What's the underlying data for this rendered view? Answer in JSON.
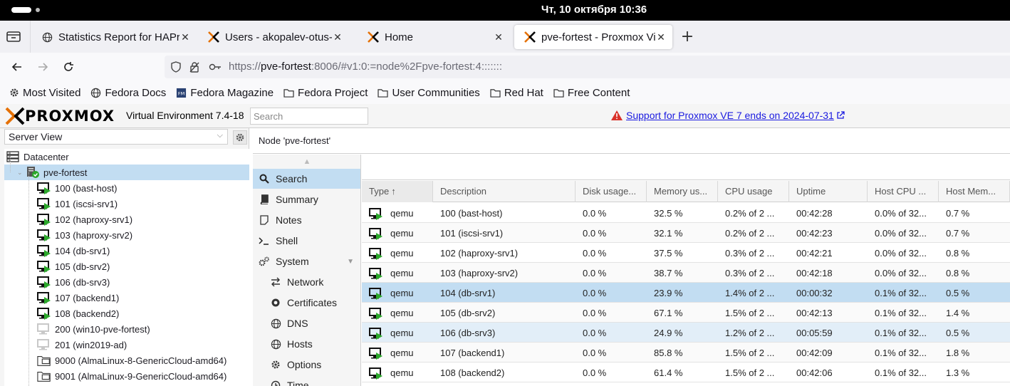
{
  "os": {
    "clock": "Чт, 10 октября  10:36"
  },
  "browser": {
    "tabs": [
      {
        "label": "Statistics Report for HAProxy",
        "icon": "globe-icon",
        "active": false
      },
      {
        "label": "Users - akopalev-otus-hl.ru",
        "icon": "proxmox-x-icon",
        "active": false
      },
      {
        "label": "Home",
        "icon": "proxmox-x-icon",
        "active": false
      },
      {
        "label": "pve-fortest - Proxmox Virtual Environment",
        "icon": "proxmox-x-icon",
        "active": true
      }
    ],
    "url_prefix": "https://",
    "url_host": "pve-fortest",
    "url_rest": ":8006/#v1:0:=node%2Fpve-fortest:4:::::::",
    "bookmarks": [
      {
        "label": "Most Visited",
        "icon": "gear-icon"
      },
      {
        "label": "Fedora Docs",
        "icon": "globe-icon"
      },
      {
        "label": "Fedora Magazine",
        "icon": "fedora-magazine-icon"
      },
      {
        "label": "Fedora Project",
        "icon": "folder-icon"
      },
      {
        "label": "User Communities",
        "icon": "folder-icon"
      },
      {
        "label": "Red Hat",
        "icon": "folder-icon"
      },
      {
        "label": "Free Content",
        "icon": "folder-icon"
      }
    ]
  },
  "pve": {
    "brand": "PROXMOX",
    "version": "Virtual Environment 7.4-18",
    "search_placeholder": "Search",
    "warning": "Support for Proxmox VE 7 ends on 2024-07-31",
    "view": "Server View",
    "tree": [
      {
        "label": "Datacenter",
        "kind": "datacenter"
      },
      {
        "label": "pve-fortest",
        "kind": "node",
        "selected": true
      },
      {
        "label": "100 (bast-host)",
        "kind": "vm-running"
      },
      {
        "label": "101 (iscsi-srv1)",
        "kind": "vm-running"
      },
      {
        "label": "102 (haproxy-srv1)",
        "kind": "vm-running"
      },
      {
        "label": "103 (haproxy-srv2)",
        "kind": "vm-running"
      },
      {
        "label": "104 (db-srv1)",
        "kind": "vm-running"
      },
      {
        "label": "105 (db-srv2)",
        "kind": "vm-running"
      },
      {
        "label": "106 (db-srv3)",
        "kind": "vm-running"
      },
      {
        "label": "107 (backend1)",
        "kind": "vm-running"
      },
      {
        "label": "108 (backend2)",
        "kind": "vm-running"
      },
      {
        "label": "200 (win10-pve-fortest)",
        "kind": "vm-stopped"
      },
      {
        "label": "201 (win2019-ad)",
        "kind": "vm-stopped"
      },
      {
        "label": "9000 (AlmaLinux-8-GenericCloud-amd64)",
        "kind": "template"
      },
      {
        "label": "9001 (AlmaLinux-9-GenericCloud-amd64)",
        "kind": "template"
      }
    ],
    "node_title": "Node 'pve-fortest'",
    "menu": [
      {
        "label": "Search",
        "icon": "search-icon",
        "selected": true
      },
      {
        "label": "Summary",
        "icon": "book-icon"
      },
      {
        "label": "Notes",
        "icon": "note-icon"
      },
      {
        "label": "Shell",
        "icon": "terminal-icon"
      },
      {
        "label": "System",
        "icon": "cogs-icon",
        "expandable": true
      },
      {
        "label": "Network",
        "icon": "network-icon",
        "sub": true
      },
      {
        "label": "Certificates",
        "icon": "certificate-icon",
        "sub": true
      },
      {
        "label": "DNS",
        "icon": "globe-icon",
        "sub": true
      },
      {
        "label": "Hosts",
        "icon": "globe-icon",
        "sub": true
      },
      {
        "label": "Options",
        "icon": "gear-icon",
        "sub": true
      },
      {
        "label": "Time",
        "icon": "clock-icon",
        "sub": true
      }
    ],
    "grid": {
      "columns": [
        "Type",
        "Description",
        "Disk usage...",
        "Memory us...",
        "CPU usage",
        "Uptime",
        "Host CPU ...",
        "Host Mem..."
      ],
      "sort_indicator": "↑",
      "rows": [
        [
          "qemu",
          "100 (bast-host)",
          "0.0 %",
          "32.5 %",
          "0.2% of 2 ...",
          "00:42:28",
          "0.0% of 32...",
          "0.7 %"
        ],
        [
          "qemu",
          "101 (iscsi-srv1)",
          "0.0 %",
          "32.1 %",
          "0.2% of 2 ...",
          "00:42:23",
          "0.0% of 32...",
          "0.7 %"
        ],
        [
          "qemu",
          "102 (haproxy-srv1)",
          "0.0 %",
          "37.5 %",
          "0.3% of 2 ...",
          "00:42:21",
          "0.0% of 32...",
          "0.8 %"
        ],
        [
          "qemu",
          "103 (haproxy-srv2)",
          "0.0 %",
          "38.7 %",
          "0.3% of 2 ...",
          "00:42:18",
          "0.0% of 32...",
          "0.8 %"
        ],
        [
          "qemu",
          "104 (db-srv1)",
          "0.0 %",
          "23.9 %",
          "1.4% of 2 ...",
          "00:00:32",
          "0.1% of 32...",
          "0.5 %"
        ],
        [
          "qemu",
          "105 (db-srv2)",
          "0.0 %",
          "67.1 %",
          "1.5% of 2 ...",
          "00:42:13",
          "0.1% of 32...",
          "1.4 %"
        ],
        [
          "qemu",
          "106 (db-srv3)",
          "0.0 %",
          "24.9 %",
          "1.2% of 2 ...",
          "00:05:59",
          "0.1% of 32...",
          "0.5 %"
        ],
        [
          "qemu",
          "107 (backend1)",
          "0.0 %",
          "85.8 %",
          "1.5% of 2 ...",
          "00:42:09",
          "0.1% of 32...",
          "1.8 %"
        ],
        [
          "qemu",
          "108 (backend2)",
          "0.0 %",
          "61.4 %",
          "1.5% of 2 ...",
          "00:42:06",
          "0.1% of 32...",
          "1.3 %"
        ]
      ],
      "selected_row": 4,
      "hover_row": 6
    }
  },
  "colors": {
    "selection": "#c2ddf2",
    "brand_orange": "#e57000",
    "running_green": "#2ba82b",
    "warning_red": "#d9322a",
    "link": "#1a1ae0"
  }
}
